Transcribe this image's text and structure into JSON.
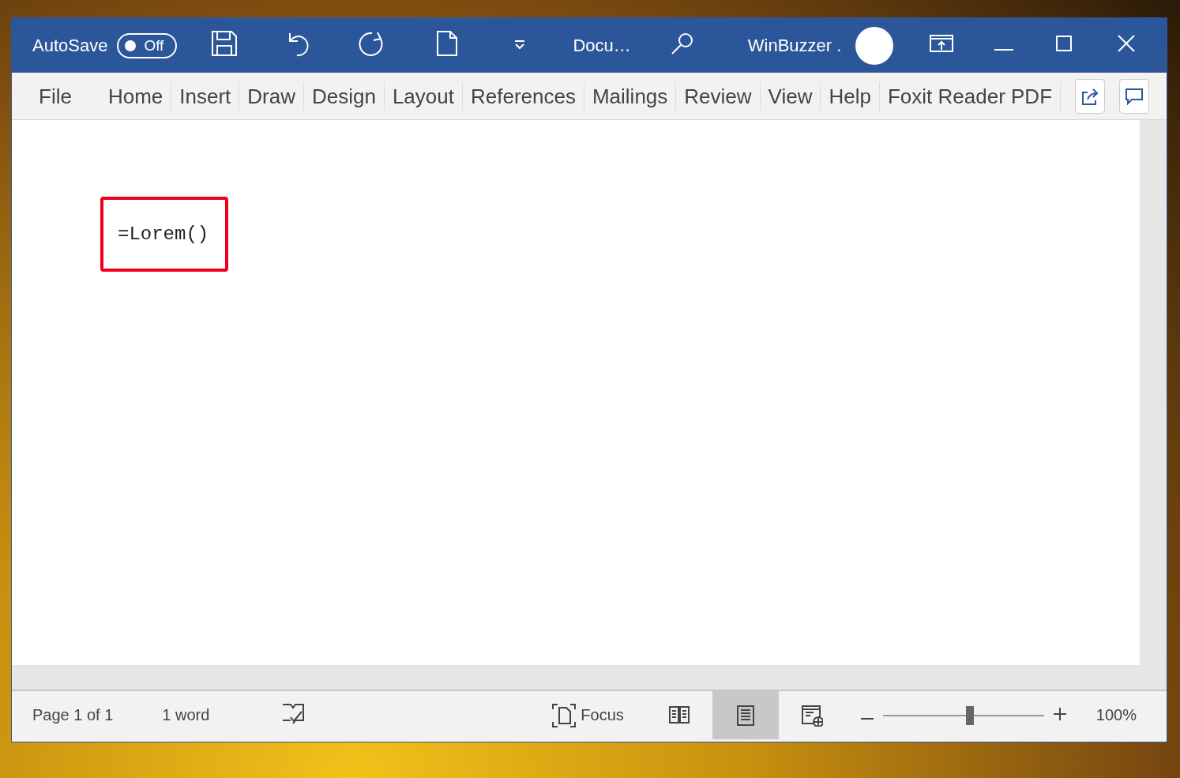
{
  "title_bar": {
    "autosave": {
      "label": "AutoSave",
      "on": false,
      "state_text": "Off"
    },
    "document_title": "Docu…",
    "user_name": "WinBuzzer ."
  },
  "ribbon_tabs": [
    "File",
    "Home",
    "Insert",
    "Draw",
    "Design",
    "Layout",
    "References",
    "Mailings",
    "Review",
    "View",
    "Help",
    "Foxit Reader PDF"
  ],
  "document": {
    "text": "=Lorem()"
  },
  "status_bar": {
    "page": "Page 1 of 1",
    "words": "1 word",
    "focus": "Focus",
    "views": [
      {
        "kind": "read",
        "selected": false
      },
      {
        "kind": "print",
        "selected": true
      },
      {
        "kind": "web",
        "selected": false
      }
    ],
    "zoom": {
      "level": 0.54,
      "reading": "100%"
    }
  }
}
